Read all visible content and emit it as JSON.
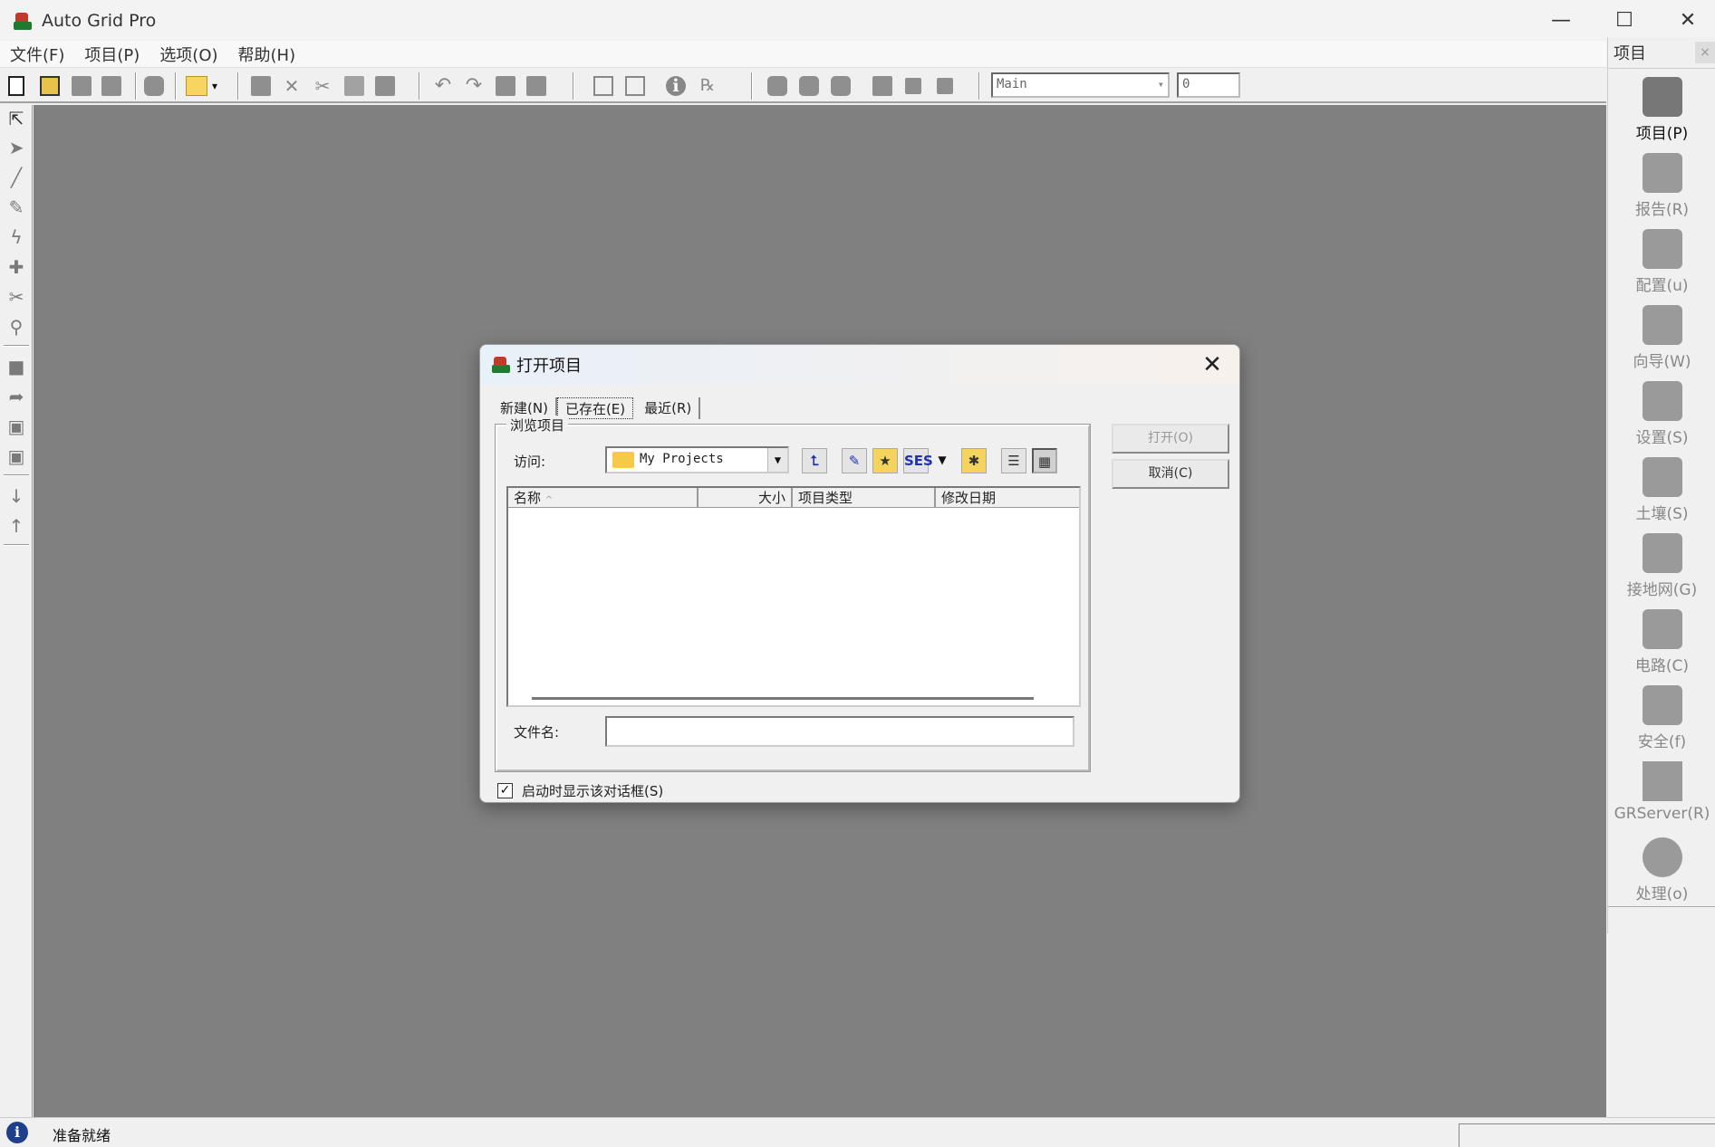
{
  "window": {
    "title": "Auto Grid Pro",
    "minimize": "—",
    "maximize": "☐",
    "close": "✕"
  },
  "menu": [
    "文件(F)",
    "项目(P)",
    "选项(O)",
    "帮助(H)"
  ],
  "toolbar": {
    "view_combo": "Main",
    "number_field": "0"
  },
  "right_panel": {
    "title": "项目",
    "close": "×",
    "items": [
      {
        "label": "项目(P)",
        "icon": "project-icon"
      },
      {
        "label": "报告(R)",
        "icon": "report-icon"
      },
      {
        "label": "配置(u)",
        "icon": "config-icon"
      },
      {
        "label": "向导(W)",
        "icon": "wizard-icon"
      },
      {
        "label": "设置(S)",
        "icon": "settings-icon"
      },
      {
        "label": "土壤(S)",
        "icon": "soil-icon"
      },
      {
        "label": "接地网(G)",
        "icon": "grounding-grid-icon"
      },
      {
        "label": "电路(C)",
        "icon": "circuit-icon"
      },
      {
        "label": "安全(f)",
        "icon": "safety-icon"
      },
      {
        "label": "GRServer(R)",
        "icon": "grserver-icon"
      },
      {
        "label": "处理(o)",
        "icon": "process-icon"
      }
    ]
  },
  "status": {
    "text": "准备就绪"
  },
  "dialog": {
    "title": "打开项目",
    "close": "✕",
    "tabs": [
      "新建(N)",
      "已存在(E)",
      "最近(R)"
    ],
    "group_label": "浏览项目",
    "lookin_label": "访问:",
    "lookin_value": "My Projects",
    "columns": [
      "名称",
      "大小",
      "项目类型",
      "修改日期"
    ],
    "filename_label": "文件名:",
    "filename_value": "",
    "open_button": "打开(O)",
    "cancel_button": "取消(C)",
    "checkbox_label": "启动时显示该对话框(S)",
    "checkbox_checked": true,
    "sort_indicator": "^",
    "list_button_icon": "SES"
  }
}
